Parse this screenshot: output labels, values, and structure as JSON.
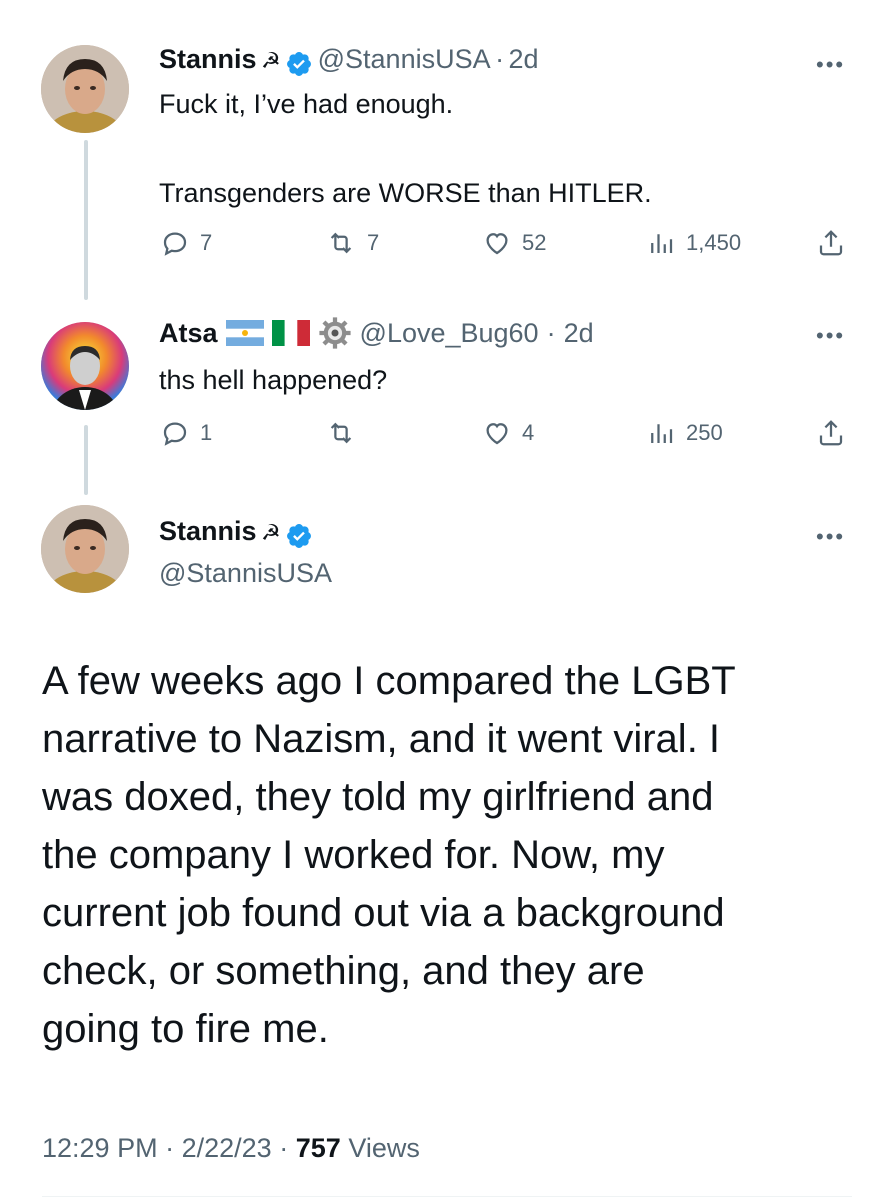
{
  "tweet1": {
    "display_name": "Stannis",
    "name_emoji": "☭",
    "handle": "@StannisUSA",
    "separator": "·",
    "time": "2d",
    "line1": "Fuck it, I’ve had enough.",
    "line2": "Transgenders are WORSE than HITLER.",
    "replies": "7",
    "retweets": "7",
    "likes": "52",
    "views": "1,450",
    "more": "•••"
  },
  "tweet2": {
    "display_name": "Atsa",
    "handle": "@Love_Bug60",
    "separator": "·",
    "time": "2d",
    "text": "ths hell happened?",
    "replies": "1",
    "retweets": "",
    "likes": "4",
    "views": "250",
    "more": "•••"
  },
  "main_tweet": {
    "display_name": "Stannis",
    "name_emoji": "☭",
    "handle": "@StannisUSA",
    "more": "•••",
    "text_lines": [
      "A few weeks ago I compared the LGBT",
      "narrative to Nazism, and it went viral. I",
      "was doxed, they told my girlfriend and",
      "the company I worked for. Now, my",
      "current job found out via a background",
      "check, or something, and they are",
      "going to fire me."
    ],
    "time": "12:29 PM",
    "separator1": "·",
    "date": "2/22/23",
    "separator2": "·",
    "views_count": "757",
    "views_label": "Views"
  },
  "colors": {
    "verified": "#1d9bf0",
    "secondary_text": "#536471",
    "thread_line": "#cfd9de"
  }
}
